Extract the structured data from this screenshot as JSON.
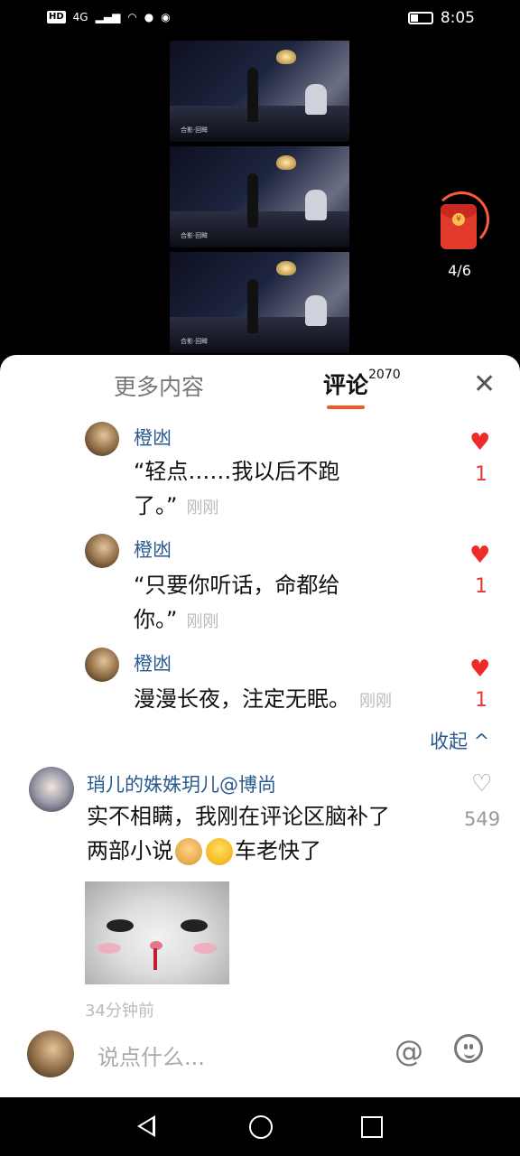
{
  "status_bar": {
    "hd": "HD",
    "network": "4G",
    "time": "8:05"
  },
  "video_panel": {
    "caption": "合影·回眸"
  },
  "red_packet": {
    "progress_text": "4/6",
    "progress_fraction": 0.67
  },
  "tabs": {
    "more": "更多内容",
    "comments": "评论",
    "comments_count": "2070"
  },
  "replies": [
    {
      "user": "橙凼",
      "text_line1": "“轻点……我以后不跑",
      "text_line2": "了。”",
      "time": "刚刚",
      "likes": "1"
    },
    {
      "user": "橙凼",
      "text_line1": "“只要你听话，命都给",
      "text_line2": "你。”",
      "time": "刚刚",
      "likes": "1"
    },
    {
      "user": "橙凼",
      "text_line1": "漫漫长夜，注定无眠。",
      "text_line2": "",
      "time": "刚刚",
      "likes": "1"
    }
  ],
  "collapse_label": "收起 ^",
  "main_comment": {
    "user": "琑儿的姝姝玥儿@博尚",
    "text_line1": "实不相瞒，我刚在评论区脑补了",
    "text_line2_a": "两部小说",
    "text_line2_b": "车老快了",
    "likes": "549",
    "time": "34分钟前",
    "emojis": [
      "doge",
      "sneeze"
    ]
  },
  "input": {
    "placeholder": "说点什么..."
  },
  "colors": {
    "accent": "#f15a24",
    "username": "#2b5a8f",
    "heart_active": "#ee2b2b"
  }
}
